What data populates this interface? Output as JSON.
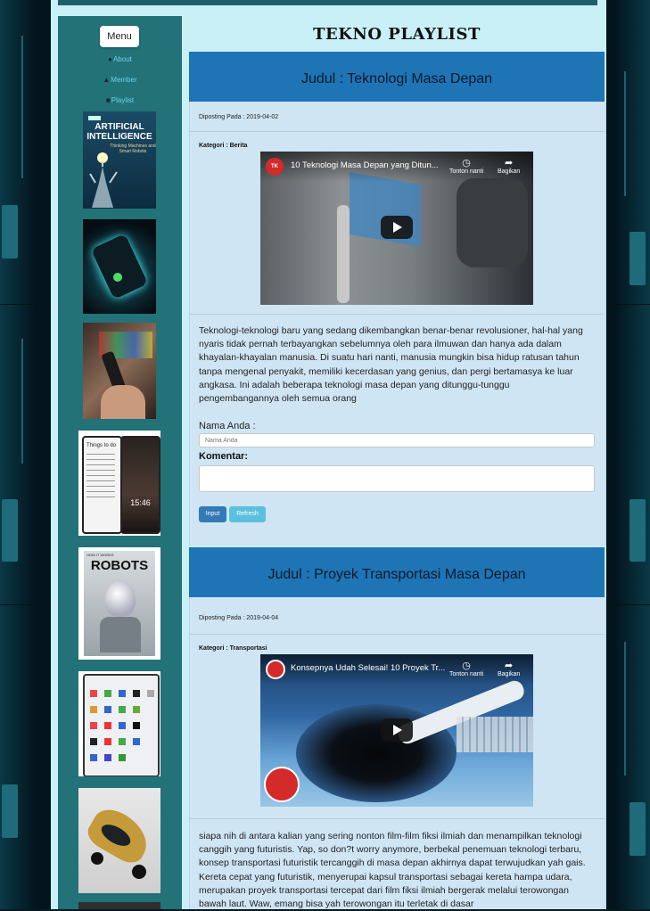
{
  "site_title": "TEKNO PLAYLIST",
  "sidebar": {
    "menu_label": "Menu",
    "nav": [
      {
        "label": "About",
        "icon": "info-circle-icon"
      },
      {
        "label": "Member",
        "icon": "user-icon"
      },
      {
        "label": "Playlist",
        "icon": "playlist-icon"
      }
    ],
    "thumbnails": [
      {
        "name": "thumb-artificial-intelligence-book",
        "text": "ARTIFICIAL INTELLIGENCE",
        "subtext": "Thinking Machines and Smart Robots"
      },
      {
        "name": "thumb-glowing-phone"
      },
      {
        "name": "thumb-remote-tv"
      },
      {
        "name": "thumb-flip-phone",
        "text": "Things to do",
        "clock": "15:46"
      },
      {
        "name": "thumb-robots-magazine",
        "text": "ROBOTS",
        "header": "HOW IT WORKS"
      },
      {
        "name": "thumb-tablet-apps"
      },
      {
        "name": "thumb-concept-car"
      }
    ]
  },
  "posts": [
    {
      "heading": "Judul : Teknologi Masa Depan",
      "posted": "Diposting Pada : 2019-04-02",
      "category": "Kategori : Berita",
      "video_title": "10 Teknologi Masa Depan yang Ditun...",
      "video_channel_badge": "TK",
      "watch_later": "Tonton nanti",
      "share": "Bagikan",
      "body": "Teknologi-teknologi baru yang sedang dikembangkan benar-benar revolusioner, hal-hal yang nyaris tidak pernah terbayangkan sebelumnya oleh para ilmuwan dan hanya ada dalam khayalan-khayalan manusia. Di suatu hari nanti, manusia mungkin bisa hidup ratusan tahun tanpa mengenal penyakit, memiliki kecerdasan yang genius, dan pergi bertamasya ke luar angkasa. Ini adalah beberapa teknologi masa depan yang ditunggu-tunggu pengembangannya oleh semua orang"
    },
    {
      "heading": "Judul : Proyek Transportasi Masa Depan",
      "posted": "Diposting Pada : 2019-04-04",
      "category": "Kategori : Transportasi",
      "video_title": "Konsepnya Udah Selesai! 10 Proyek Tr...",
      "watch_later": "Tonton nanti",
      "share": "Bagikan",
      "body": "siapa nih di antara kalian yang sering nonton film-film fiksi ilmiah dan menampilkan teknologi canggih yang futuristis. Yap, so don?t worry anymore, berbekal penemuan teknologi terbaru, konsep transportasi futuristik tercanggih di masa depan akhirnya dapat terwujudkan yah gais. Kereta cepat yang futuristik, menyerupai kapsul transportasi sebagai kereta hampa udara, merupakan proyek transportasi tercepat dari film fiksi ilmiah bergerak melalui terowongan bawah laut. Waw, emang bisa yah terowongan itu terletak di dasar"
    }
  ],
  "comment_form": {
    "name_label": "Nama Anda :",
    "name_placeholder": "Nama Anda",
    "comment_label": "Komentar:",
    "input_button": "Input",
    "refresh_button": "Refresh"
  },
  "colors": {
    "page_bg": "#c9f0f6",
    "sidebar_bg": "#227278",
    "card_header": "#1f74b6",
    "card_body": "#cfe5f4",
    "input_button": "#337ab7",
    "refresh_button": "#5bc0de"
  }
}
